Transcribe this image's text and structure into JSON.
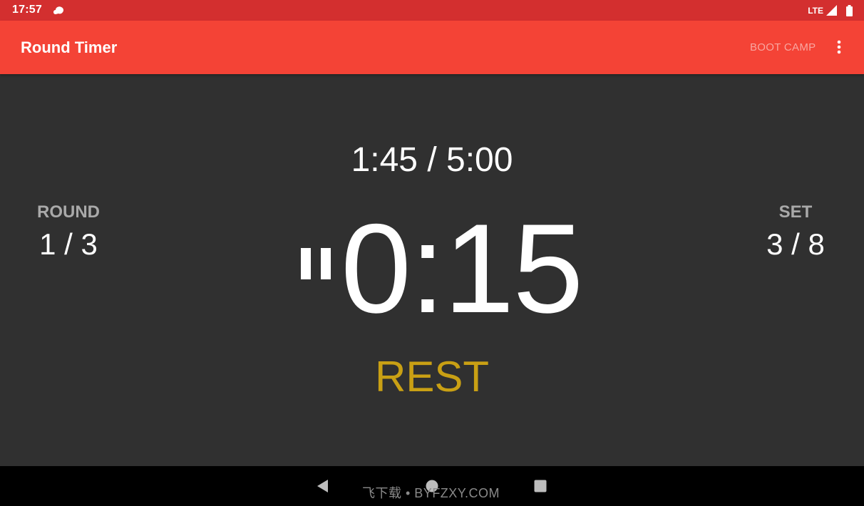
{
  "status_bar": {
    "time": "17:57",
    "network": "LTE",
    "icons": [
      "cloud-icon",
      "signal-icon",
      "battery-icon"
    ]
  },
  "app_bar": {
    "title": "Round Timer",
    "action_label": "BOOT CAMP",
    "menu_icon": "more-vert-icon",
    "background_color": "#f44336"
  },
  "timer": {
    "total_elapsed": "1:45 / 5:00",
    "current_time": "0:15",
    "phase": "REST",
    "phase_color": "#c9a014",
    "state_icon": "pause-icon"
  },
  "round": {
    "label": "ROUND",
    "value": "1 / 3"
  },
  "set": {
    "label": "SET",
    "value": "3 / 8"
  },
  "nav_bar": {
    "icons": [
      "back-icon",
      "home-icon",
      "recents-icon"
    ]
  },
  "watermark": {
    "text": "飞下载 • BYFZXY.COM"
  }
}
